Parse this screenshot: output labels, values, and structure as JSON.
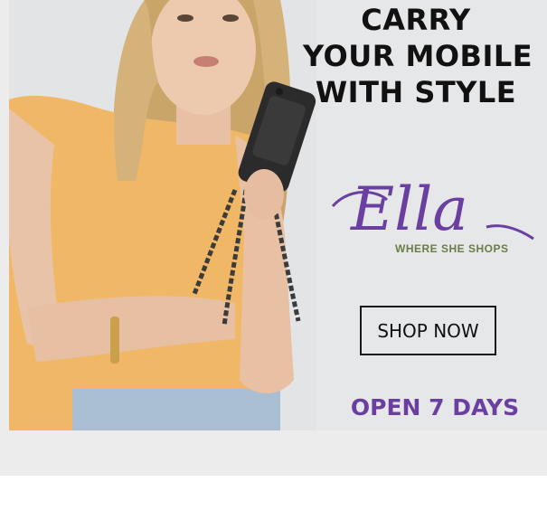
{
  "ad": {
    "headline_lines": [
      "CARRY",
      "YOUR MOBILE",
      "WITH STYLE"
    ],
    "brand": {
      "logo_text": "Ella",
      "tagline": "WHERE SHE SHOPS",
      "logo_color": "#6b3fa0",
      "tagline_color": "#6b7d46"
    },
    "cta_label": "SHOP NOW",
    "hours_text": "OPEN 7 DAYS",
    "hero_image": "woman-with-phone-crossbody-case"
  }
}
